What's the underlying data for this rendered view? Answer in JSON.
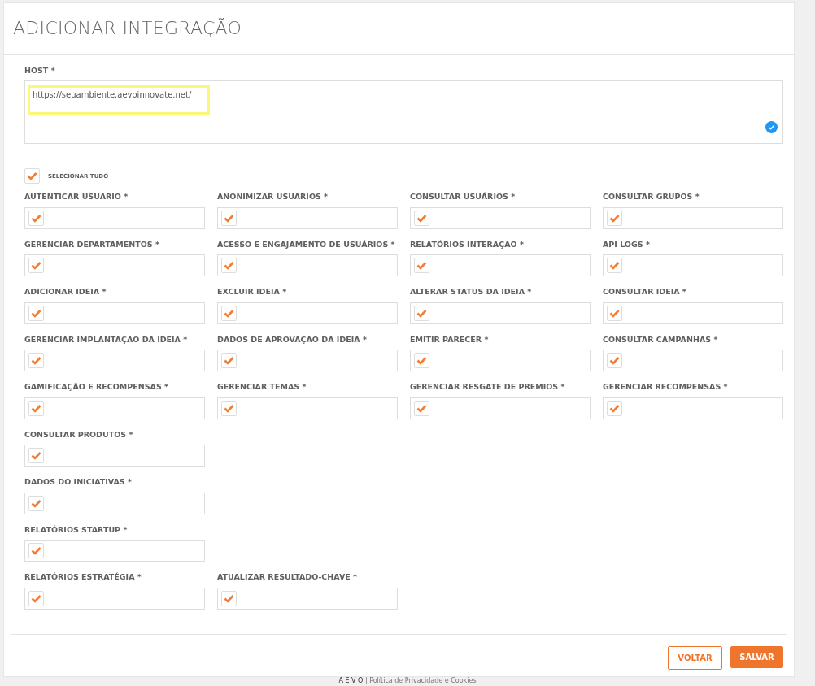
{
  "title": "ADICIONAR INTEGRAÇÃO",
  "host": {
    "label": "HOST *",
    "value": "https://seuambiente.aevoinnovate.net/",
    "highlighted": true,
    "valid": true
  },
  "select_all": {
    "label": "SELECIONAR TUDO",
    "checked": true
  },
  "permission_rows": [
    [
      {
        "label": "AUTENTICAR USUARIO *",
        "checked": true
      },
      {
        "label": "ANONIMIZAR USUARIOS *",
        "checked": true
      },
      {
        "label": "CONSULTAR USUÁRIOS *",
        "checked": true
      },
      {
        "label": "CONSULTAR GRUPOS *",
        "checked": true
      }
    ],
    [
      {
        "label": "GERENCIAR DEPARTAMENTOS *",
        "checked": true
      },
      {
        "label": "ACESSO E ENGAJAMENTO DE USUÁRIOS *",
        "checked": true
      },
      {
        "label": "RELATÓRIOS INTERAÇÃO *",
        "checked": true
      },
      {
        "label": "API LOGS *",
        "checked": true
      }
    ],
    [
      {
        "label": "ADICIONAR IDEIA *",
        "checked": true
      },
      {
        "label": "EXCLUIR IDEIA *",
        "checked": true
      },
      {
        "label": "ALTERAR STATUS DA IDEIA *",
        "checked": true
      },
      {
        "label": "CONSULTAR IDEIA *",
        "checked": true
      }
    ],
    [
      {
        "label": "GERENCIAR IMPLANTAÇÃO DA IDEIA *",
        "checked": true
      },
      {
        "label": "DADOS DE APROVAÇÃO DA IDEIA *",
        "checked": true
      },
      {
        "label": "EMITIR PARECER *",
        "checked": true
      },
      {
        "label": "CONSULTAR CAMPANHAS *",
        "checked": true
      }
    ],
    [
      {
        "label": "GAMIFICAÇÃO E RECOMPENSAS *",
        "checked": true
      },
      {
        "label": "GERENCIAR TEMAS *",
        "checked": true
      },
      {
        "label": "GERENCIAR RESGATE DE PREMIOS *",
        "checked": true
      },
      {
        "label": "GERENCIAR RECOMPENSAS *",
        "checked": true
      }
    ],
    [
      {
        "label": "CONSULTAR PRODUTOS *",
        "checked": true
      }
    ],
    [
      {
        "label": "DADOS DO INICIATIVAS *",
        "checked": true
      }
    ],
    [
      {
        "label": "RELATÓRIOS STARTUP *",
        "checked": true
      }
    ],
    [
      {
        "label": "RELATÓRIOS ESTRATÉGIA *",
        "checked": true
      },
      {
        "label": "ATUALIZAR RESULTADO-CHAVE *",
        "checked": true
      }
    ]
  ],
  "buttons": [
    {
      "label": "VOLTAR",
      "kind": "outline"
    },
    {
      "label": "SALVAR",
      "kind": "primary"
    }
  ],
  "footer": {
    "brand": "A E V O",
    "link": "| Política de Privacidade e Cookies"
  }
}
